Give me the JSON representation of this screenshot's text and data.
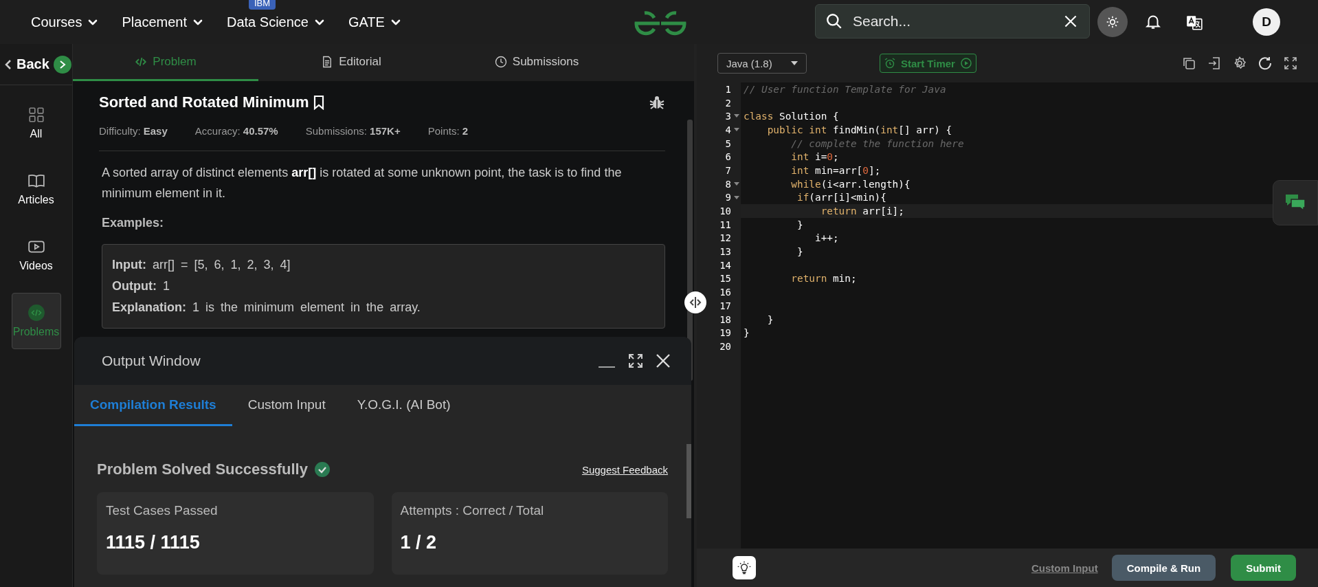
{
  "nav": {
    "items": [
      {
        "label": "Courses"
      },
      {
        "label": "Placement"
      },
      {
        "label": "Data Science",
        "badge": "IBM"
      },
      {
        "label": "GATE"
      }
    ],
    "search": {
      "placeholder": "Search..."
    },
    "avatar": "D"
  },
  "sidebar": {
    "back": "Back",
    "items": [
      {
        "label": "All",
        "kind": "grid",
        "selected": false
      },
      {
        "label": "Articles",
        "kind": "book",
        "selected": false
      },
      {
        "label": "Videos",
        "kind": "play",
        "selected": false
      },
      {
        "label": "Problems",
        "kind": "code",
        "selected": true
      }
    ]
  },
  "problem_tabs": [
    {
      "label": "Problem",
      "kind": "code",
      "selected": true
    },
    {
      "label": "Editorial",
      "kind": "doc",
      "selected": false
    },
    {
      "label": "Submissions",
      "kind": "clock",
      "selected": false
    }
  ],
  "problem": {
    "title": "Sorted and Rotated Minimum",
    "meta": [
      {
        "label": "Difficulty:",
        "value": "Easy"
      },
      {
        "label": "Accuracy:",
        "value": "40.57%"
      },
      {
        "label": "Submissions:",
        "value": "157K+"
      },
      {
        "label": "Points:",
        "value": "2"
      }
    ],
    "description": "A sorted array of distinct elements **arr[]** is rotated at some unknown point, the task is to find the minimum element in it.",
    "examples_heading": "Examples:",
    "example": [
      {
        "label": "Input:",
        "value": "arr[] = [5, 6, 1, 2, 3, 4]"
      },
      {
        "label": "Output:",
        "value": "1"
      },
      {
        "label": "Explanation:",
        "value": "1 is the minimum element in the array."
      }
    ]
  },
  "output_window": {
    "title": "Output Window",
    "tabs": [
      {
        "label": "Compilation Results",
        "selected": true
      },
      {
        "label": "Custom Input",
        "selected": false
      },
      {
        "label": "Y.O.G.I. (AI Bot)",
        "selected": false
      }
    ],
    "status": "Problem Solved Successfully",
    "feedback_link": "Suggest Feedback",
    "cards": [
      {
        "label": "Test Cases Passed",
        "value": "1115 / 1115"
      },
      {
        "label": "Attempts : Correct / Total",
        "value": "1 / 2"
      }
    ]
  },
  "editor": {
    "language": "Java (1.8)",
    "timer_button": "Start Timer",
    "lines": [
      {
        "number": "1",
        "fold": false,
        "current": false,
        "tokens": [
          {
            "text": "// User function Template for Java",
            "kind": "comment"
          }
        ]
      },
      {
        "number": "2",
        "fold": false,
        "current": false
      },
      {
        "number": "3",
        "fold": true,
        "current": false,
        "tokens": [
          {
            "text": "class",
            "kind": "keyword"
          },
          {
            "text": " Solution {",
            "kind": "plain"
          }
        ]
      },
      {
        "number": "4",
        "fold": true,
        "current": false,
        "tokens": [
          {
            "text": "    public int",
            "kind": "keyword"
          },
          {
            "text": " findMin(",
            "kind": "plain"
          },
          {
            "text": "int",
            "kind": "keyword"
          },
          {
            "text": "[] arr) {",
            "kind": "plain"
          }
        ]
      },
      {
        "number": "5",
        "fold": false,
        "current": false,
        "tokens": [
          {
            "text": "        // complete the function here",
            "kind": "comment"
          }
        ]
      },
      {
        "number": "6",
        "fold": false,
        "current": false,
        "tokens": [
          {
            "text": "        int",
            "kind": "keyword"
          },
          {
            "text": " i=",
            "kind": "plain"
          },
          {
            "text": "0",
            "kind": "number"
          },
          {
            "text": ";",
            "kind": "plain"
          }
        ]
      },
      {
        "number": "7",
        "fold": false,
        "current": false,
        "tokens": [
          {
            "text": "        int",
            "kind": "keyword"
          },
          {
            "text": " min=arr[",
            "kind": "plain"
          },
          {
            "text": "0",
            "kind": "number"
          },
          {
            "text": "];",
            "kind": "plain"
          }
        ]
      },
      {
        "number": "8",
        "fold": true,
        "current": false,
        "tokens": [
          {
            "text": "        while",
            "kind": "keyword"
          },
          {
            "text": "(i<arr.length){",
            "kind": "plain"
          }
        ]
      },
      {
        "number": "9",
        "fold": true,
        "current": false,
        "tokens": [
          {
            "text": "         if",
            "kind": "keyword"
          },
          {
            "text": "(arr[i]<min){",
            "kind": "plain"
          }
        ]
      },
      {
        "number": "10",
        "fold": false,
        "current": true,
        "tokens": [
          {
            "text": "             return",
            "kind": "keyword"
          },
          {
            "text": " arr[i];",
            "kind": "plain"
          }
        ]
      },
      {
        "number": "11",
        "fold": false,
        "current": false,
        "tokens": [
          {
            "text": "         }",
            "kind": "plain"
          }
        ]
      },
      {
        "number": "12",
        "fold": false,
        "current": false,
        "tokens": [
          {
            "text": "            i++;",
            "kind": "plain"
          }
        ]
      },
      {
        "number": "13",
        "fold": false,
        "current": false,
        "tokens": [
          {
            "text": "         }",
            "kind": "plain"
          }
        ]
      },
      {
        "number": "14",
        "fold": false,
        "current": false
      },
      {
        "number": "15",
        "fold": false,
        "current": false,
        "tokens": [
          {
            "text": "        return",
            "kind": "keyword"
          },
          {
            "text": " min;",
            "kind": "plain"
          }
        ]
      },
      {
        "number": "16",
        "fold": false,
        "current": false
      },
      {
        "number": "17",
        "fold": false,
        "current": false
      },
      {
        "number": "18",
        "fold": false,
        "current": false,
        "tokens": [
          {
            "text": "    }",
            "kind": "plain"
          }
        ]
      },
      {
        "number": "19",
        "fold": false,
        "current": false,
        "tokens": [
          {
            "text": "}",
            "kind": "plain"
          }
        ]
      },
      {
        "number": "20",
        "fold": false,
        "current": false
      }
    ],
    "custom_input_link": "Custom Input",
    "compile_button": "Compile & Run",
    "submit_button": "Submit"
  }
}
